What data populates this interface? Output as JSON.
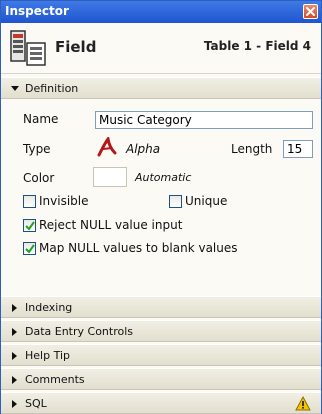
{
  "window": {
    "title": "Inspector"
  },
  "header": {
    "title": "Field",
    "location": "Table 1 - Field 4"
  },
  "definition": {
    "section_label": "Definition",
    "name_label": "Name",
    "name_value": "Music Category",
    "type_label": "Type",
    "type_value": "Alpha",
    "length_label": "Length",
    "length_value": "15",
    "color_label": "Color",
    "color_value": "Automatic",
    "invisible_label": "Invisible",
    "invisible_checked": false,
    "unique_label": "Unique",
    "unique_checked": false,
    "reject_null_label": "Reject NULL value input",
    "reject_null_checked": true,
    "map_null_label": "Map NULL values to blank values",
    "map_null_checked": true
  },
  "sections": {
    "indexing": "Indexing",
    "data_entry": "Data Entry Controls",
    "help_tip": "Help Tip",
    "comments": "Comments",
    "sql": "SQL"
  },
  "colors": {
    "titlebar": "#2a60d8",
    "check": "#21a121",
    "warning": "#f5c400"
  }
}
